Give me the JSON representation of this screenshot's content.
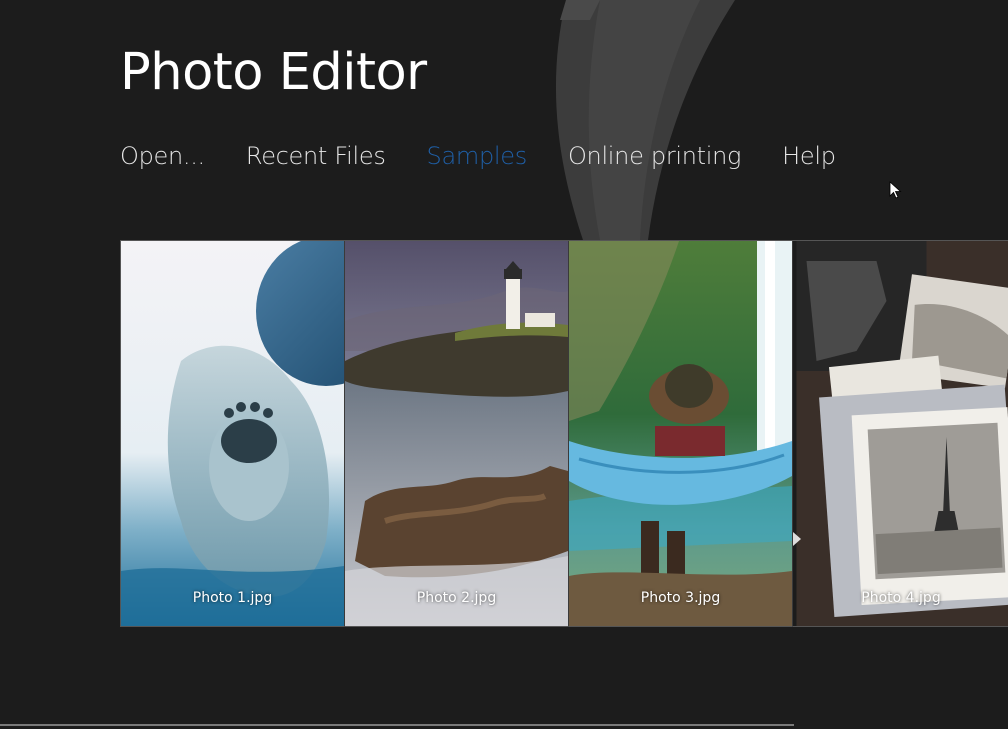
{
  "app": {
    "title": "Photo Editor",
    "accent_color": "#1f5fa6",
    "background_color": "#1c1c1c"
  },
  "nav": {
    "items": [
      {
        "label": "Open...",
        "active": false
      },
      {
        "label": "Recent Files",
        "active": false
      },
      {
        "label": "Samples",
        "active": true
      },
      {
        "label": "Online printing",
        "active": false
      },
      {
        "label": "Help",
        "active": false
      }
    ]
  },
  "gallery": {
    "photos": [
      {
        "caption": "Photo 1.jpg",
        "subject": "polar bear swimming underwater"
      },
      {
        "caption": "Photo 2.jpg",
        "subject": "lighthouse on rocky coast at dusk"
      },
      {
        "caption": "Photo 3.jpg",
        "subject": "person in blue hammock by waterfall"
      },
      {
        "caption": "Photo 4.jpg",
        "subject": "vintage photographs with Eiffel Tower"
      }
    ]
  },
  "icons": {
    "cursor": "mouse-pointer-icon",
    "scroll": "chevron-right-icon"
  }
}
